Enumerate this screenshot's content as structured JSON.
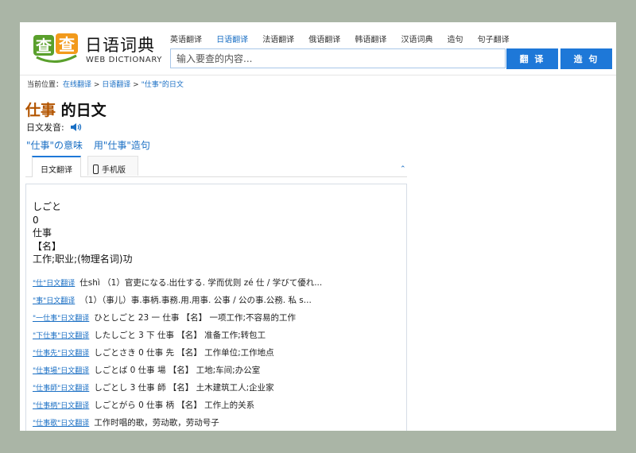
{
  "header": {
    "logo_icon_text": "查查",
    "logo_title": "日语词典",
    "logo_subtitle": "WEB DICTIONARY",
    "nav": [
      {
        "label": "英语翻译",
        "active": false
      },
      {
        "label": "日语翻译",
        "active": true
      },
      {
        "label": "法语翻译",
        "active": false
      },
      {
        "label": "俄语翻译",
        "active": false
      },
      {
        "label": "韩语翻译",
        "active": false
      },
      {
        "label": "汉语词典",
        "active": false
      },
      {
        "label": "造句",
        "active": false
      },
      {
        "label": "句子翻译",
        "active": false
      }
    ],
    "search_placeholder": "输入要查的内容...",
    "translate_button": "翻 译",
    "sentence_button": "造 句"
  },
  "breadcrumb": {
    "prefix": "当前位置：",
    "items": [
      "在线翻译",
      "日语翻译",
      "\"仕事\"的日文"
    ],
    "separator": " > "
  },
  "title": {
    "word": "仕事",
    "suffix": " 的日文"
  },
  "pronunciation_label": "日文发音:",
  "links": [
    "\"仕事\"の意味",
    "用\"仕事\"造句"
  ],
  "tabs": {
    "japanese": "日文翻译",
    "mobile": "手机版"
  },
  "definition": {
    "lines": [
      "しごと",
      "0",
      "仕事",
      "【名】",
      "工作;职业;(物理名词)功"
    ]
  },
  "related": [
    {
      "link": "\"仕\"日文翻译",
      "text": "仕shì （1）官吏になる.出仕する. 学而优则 zé 仕 / 学びて優れ..."
    },
    {
      "link": "\"事\"日文翻译",
      "text": "（1）（事儿）事.事柄.事務.用.用事. 公事 / 公の事.公務. 私 s..."
    },
    {
      "link": "\"一仕事\"日文翻译",
      "text": "ひとしごと 23 一 仕事 【名】 一项工作;不容易的工作"
    },
    {
      "link": "\"下仕事\"日文翻译",
      "text": "したしごと 3 下 仕事 【名】 准备工作;转包工"
    },
    {
      "link": "\"仕事先\"日文翻译",
      "text": "しごとさき 0 仕事 先 【名】 工作单位;工作地点"
    },
    {
      "link": "\"仕事場\"日文翻译",
      "text": "しごとば 0 仕事 場 【名】 工地;车间;办公室"
    },
    {
      "link": "\"仕事師\"日文翻译",
      "text": "しごとし 3 仕事 師 【名】 土木建筑工人;企业家"
    },
    {
      "link": "\"仕事柄\"日文翻译",
      "text": "しごとがら 0 仕事 柄 【名】 工作上的关系"
    },
    {
      "link": "\"仕事歌\"日文翻译",
      "text": "工作时唱的歌，劳动歌，劳动号子"
    }
  ],
  "colors": {
    "link": "#1a6fc4",
    "button": "#1e78d8",
    "title_word": "#b35500",
    "logo_green": "#5aa02c",
    "logo_orange": "#f29a1b"
  }
}
